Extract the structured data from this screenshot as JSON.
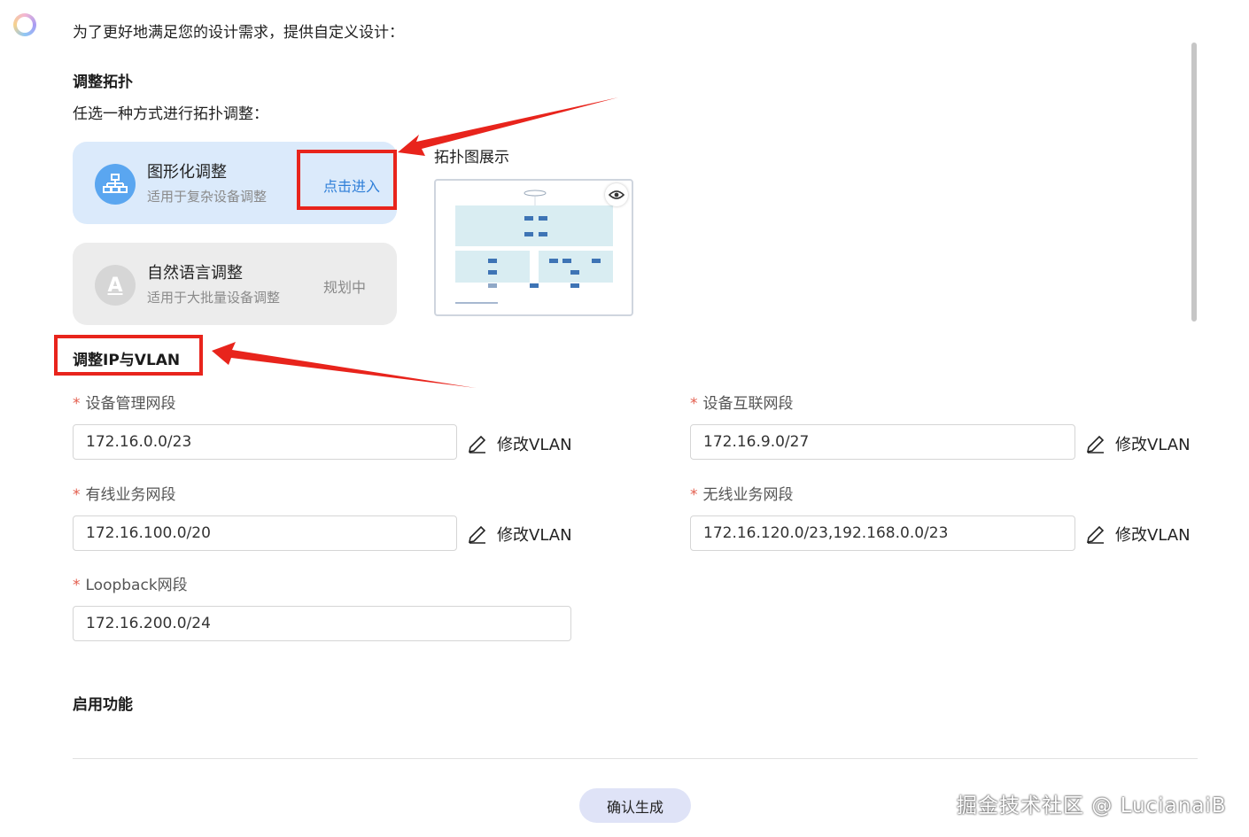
{
  "intro_text": "为了更好地满足您的设计需求，提供自定义设计：",
  "topology": {
    "section_title": "调整拓扑",
    "subtitle": "任选一种方式进行拓扑调整：",
    "graph_mode": {
      "title": "图形化调整",
      "subtitle": "适用于复杂设备调整",
      "action": "点击进入"
    },
    "nlp_mode": {
      "icon_letter": "A",
      "title": "自然语言调整",
      "subtitle": "适用于大批量设备调整",
      "status": "规划中"
    },
    "preview_label": "拓扑图展示"
  },
  "ip_vlan": {
    "section_title": "调整IP与VLAN",
    "required_mark": "*",
    "edit_label": "修改VLAN",
    "fields": {
      "mgmt": {
        "label": "设备管理网段",
        "value": "172.16.0.0/23"
      },
      "interconnect": {
        "label": "设备互联网段",
        "value": "172.16.9.0/27"
      },
      "wired": {
        "label": "有线业务网段",
        "value": "172.16.100.0/20"
      },
      "wireless": {
        "label": "无线业务网段",
        "value": "172.16.120.0/23,192.168.0.0/23"
      },
      "loopback": {
        "label": "Loopback网段",
        "value": "172.16.200.0/24"
      }
    }
  },
  "features": {
    "section_title": "启用功能"
  },
  "confirm_button": "确认生成",
  "watermark": "掘金技术社区 @ LucianaiB",
  "colors": {
    "accent_blue": "#2f7fd8",
    "annotation_red": "#e8241c",
    "card_blue": "#dbeafb"
  }
}
